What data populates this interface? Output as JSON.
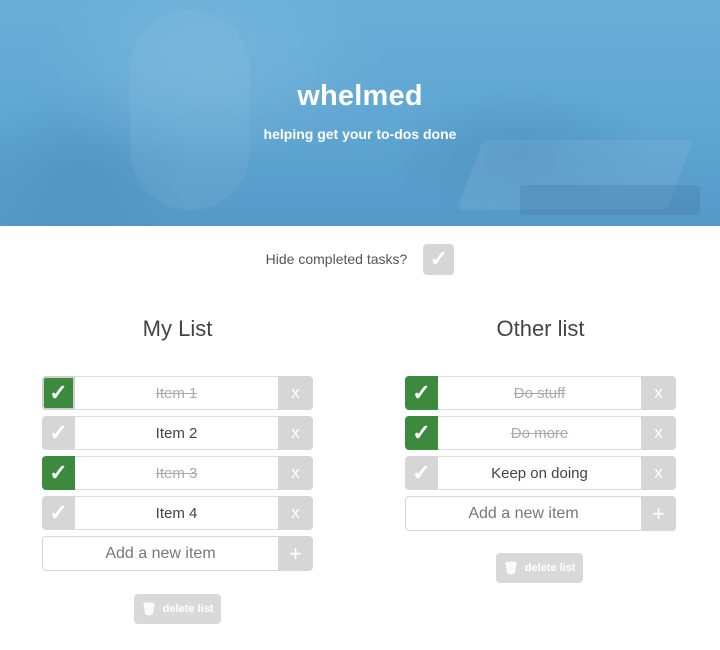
{
  "hero": {
    "title": "whelmed",
    "subtitle": "helping get your to-dos done"
  },
  "filter": {
    "label": "Hide completed tasks?",
    "checked": false
  },
  "lists": [
    {
      "title": "My List",
      "items": [
        {
          "text": "Item 1",
          "done": true
        },
        {
          "text": "Item 2",
          "done": false
        },
        {
          "text": "Item 3",
          "done": true
        },
        {
          "text": "Item 4",
          "done": false
        }
      ],
      "add_placeholder": "Add a new item",
      "delete_label": "delete list"
    },
    {
      "title": "Other list",
      "items": [
        {
          "text": "Do stuff",
          "done": true
        },
        {
          "text": "Do more",
          "done": true
        },
        {
          "text": "Keep on doing",
          "done": false
        }
      ],
      "add_placeholder": "Add a new item",
      "delete_label": "delete list"
    }
  ],
  "glyphs": {
    "check": "✓",
    "remove": "x",
    "add": "+",
    "trash": "🗑"
  },
  "colors": {
    "done": "#3b8a3e",
    "inactive": "#d6d6d6",
    "hero": "#5fa6d2"
  }
}
